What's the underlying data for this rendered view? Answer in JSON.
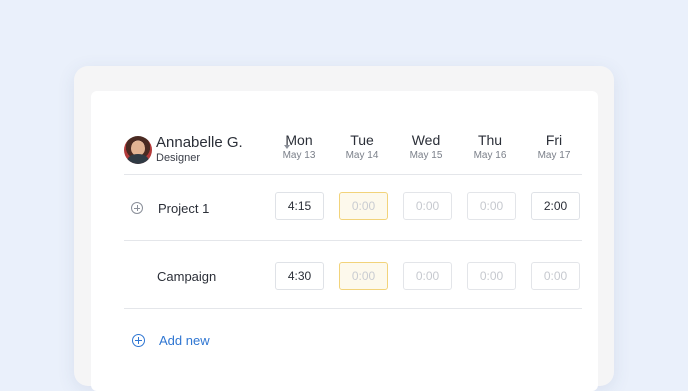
{
  "user": {
    "name": "Annabelle G.",
    "role": "Designer"
  },
  "days": [
    {
      "name": "Mon",
      "date": "May 13"
    },
    {
      "name": "Tue",
      "date": "May 14"
    },
    {
      "name": "Wed",
      "date": "May 15"
    },
    {
      "name": "Thu",
      "date": "May 16"
    },
    {
      "name": "Fri",
      "date": "May 17"
    }
  ],
  "rows": [
    {
      "label": "Project 1",
      "cells": [
        "4:15",
        "0:00",
        "0:00",
        "0:00",
        "2:00"
      ]
    },
    {
      "label": "Campaign",
      "cells": [
        "4:30",
        "0:00",
        "0:00",
        "0:00",
        "0:00"
      ]
    }
  ],
  "add_new_label": "Add new",
  "colors": {
    "accent": "#2f76d2",
    "highlight_border": "#f2d37a",
    "background": "#eaf0fb"
  },
  "icons": {
    "row_add": "plus-circle-icon",
    "dropdown": "caret-down-icon",
    "add_new": "plus-circle-icon"
  }
}
